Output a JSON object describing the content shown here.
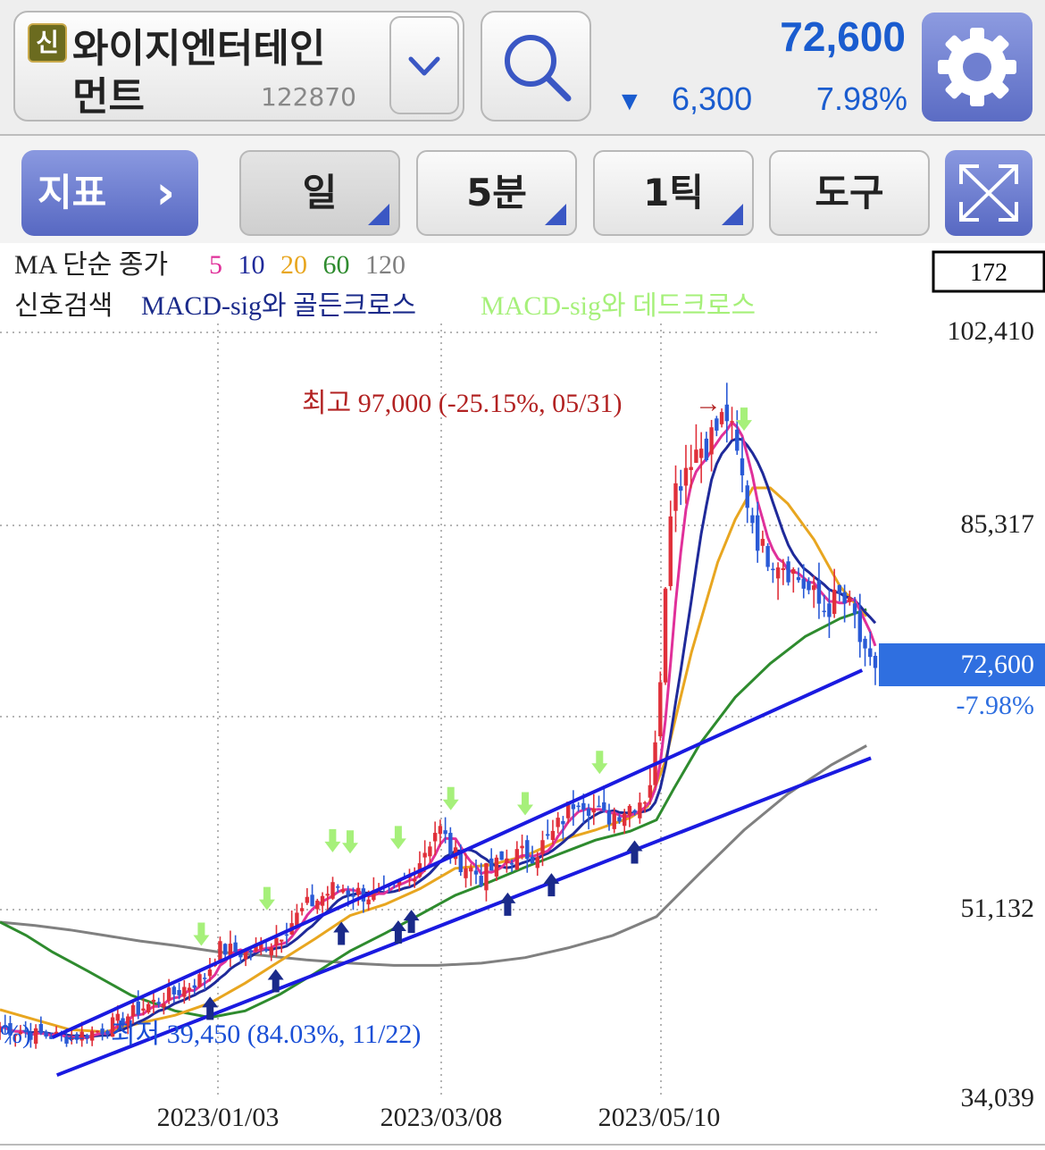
{
  "header": {
    "badge": "신",
    "name_line1": "와이지엔터테인",
    "name_line2": "먼트",
    "code": "122870",
    "price": "72,600",
    "change_arrow": "▼",
    "change_amount": "6,300",
    "change_pct": "7.98%"
  },
  "toolbar": {
    "indicator_label": "지표",
    "indicator_arrow": "›",
    "period_day": "일",
    "period_5min": "5분",
    "period_tick": "1틱",
    "tools": "도구"
  },
  "legend": {
    "ma_prefix": "MA 단순 종가",
    "ma_periods": [
      {
        "label": "5",
        "color": "#e0309a"
      },
      {
        "label": "10",
        "color": "#1f2a9a"
      },
      {
        "label": "20",
        "color": "#e8a620"
      },
      {
        "label": "60",
        "color": "#2e8b2e"
      },
      {
        "label": "120",
        "color": "#808080"
      }
    ],
    "signal_prefix": "신호검색",
    "signal_golden": "MACD-sig와 골든크로스",
    "signal_dead": "MACD-sig와 데드크로스",
    "count_box": "172"
  },
  "colors": {
    "up": "#e0303a",
    "down": "#2a5ad6",
    "trend": "#1a1ae0",
    "golden_arrow": "#1a2a8a",
    "dead_arrow": "#a6f07a",
    "high_label": "#b22222",
    "low_label": "#1a4fd6"
  },
  "chart_data": {
    "type": "candlestick",
    "y_ticks": [
      {
        "label": "102,410",
        "value": 102410
      },
      {
        "label": "85,317",
        "value": 85317
      },
      {
        "label": "51,132",
        "value": 51132
      },
      {
        "label": "34,039",
        "value": 34039
      }
    ],
    "x_ticks": [
      "2023/01/03",
      "2023/03/08",
      "2023/05/10"
    ],
    "current_price_label": "72,600",
    "current_change_label": "-7.98%",
    "high_annotation": "최고 97,000 (-25.15%, 05/31)",
    "high_annotation_arrow": "→",
    "low_annotation": "최저 39,450 (84.03%, 11/22)",
    "low_annotation_arrow": "←",
    "low_annotation_left_edge": "%)",
    "high_value": 97000,
    "low_value": 39450,
    "last_close": 72600,
    "trend_lines": [
      {
        "from": [
          0.06,
          39600
        ],
        "to": [
          0.985,
          72400
        ]
      },
      {
        "from": [
          0.065,
          36200
        ],
        "to": [
          0.995,
          64600
        ]
      }
    ],
    "guide_points": {
      "close": [
        [
          0.0,
          40500
        ],
        [
          0.04,
          39900
        ],
        [
          0.08,
          39600
        ],
        [
          0.12,
          40400
        ],
        [
          0.16,
          42200
        ],
        [
          0.2,
          43600
        ],
        [
          0.235,
          45200
        ],
        [
          0.25,
          47600
        ],
        [
          0.28,
          47200
        ],
        [
          0.31,
          48200
        ],
        [
          0.35,
          51400
        ],
        [
          0.385,
          53200
        ],
        [
          0.41,
          52600
        ],
        [
          0.44,
          52200
        ],
        [
          0.47,
          54200
        ],
        [
          0.5,
          58600
        ],
        [
          0.52,
          55800
        ],
        [
          0.55,
          54000
        ],
        [
          0.58,
          55800
        ],
        [
          0.61,
          56200
        ],
        [
          0.63,
          57600
        ],
        [
          0.66,
          61400
        ],
        [
          0.69,
          59200
        ],
        [
          0.72,
          60400
        ],
        [
          0.74,
          61400
        ],
        [
          0.75,
          66000
        ],
        [
          0.765,
          87400
        ],
        [
          0.79,
          91800
        ],
        [
          0.81,
          92800
        ],
        [
          0.83,
          95200
        ],
        [
          0.85,
          88600
        ],
        [
          0.87,
          83000
        ],
        [
          0.89,
          82400
        ],
        [
          0.91,
          80800
        ],
        [
          0.94,
          77800
        ],
        [
          0.96,
          78800
        ],
        [
          0.975,
          77400
        ],
        [
          0.99,
          72600
        ]
      ],
      "ma20": [
        [
          0.0,
          42100
        ],
        [
          0.04,
          41200
        ],
        [
          0.08,
          40300
        ],
        [
          0.12,
          40100
        ],
        [
          0.16,
          40900
        ],
        [
          0.2,
          41600
        ],
        [
          0.24,
          42700
        ],
        [
          0.28,
          44500
        ],
        [
          0.32,
          46500
        ],
        [
          0.36,
          48500
        ],
        [
          0.4,
          50600
        ],
        [
          0.44,
          51600
        ],
        [
          0.48,
          53000
        ],
        [
          0.52,
          54800
        ],
        [
          0.56,
          55100
        ],
        [
          0.6,
          55900
        ],
        [
          0.64,
          57300
        ],
        [
          0.68,
          58200
        ],
        [
          0.72,
          59300
        ],
        [
          0.74,
          60300
        ],
        [
          0.76,
          64300
        ],
        [
          0.79,
          74000
        ],
        [
          0.82,
          82000
        ],
        [
          0.84,
          85800
        ],
        [
          0.86,
          88600
        ],
        [
          0.88,
          88600
        ],
        [
          0.9,
          87200
        ],
        [
          0.93,
          84000
        ],
        [
          0.96,
          79800
        ],
        [
          0.99,
          77200
        ]
      ],
      "ma60": [
        [
          0.0,
          50000
        ],
        [
          0.03,
          48800
        ],
        [
          0.06,
          47300
        ],
        [
          0.1,
          45600
        ],
        [
          0.15,
          43400
        ],
        [
          0.2,
          42000
        ],
        [
          0.24,
          41400
        ],
        [
          0.28,
          42000
        ],
        [
          0.32,
          43500
        ],
        [
          0.36,
          45400
        ],
        [
          0.4,
          47400
        ],
        [
          0.44,
          49000
        ],
        [
          0.48,
          50700
        ],
        [
          0.52,
          52400
        ],
        [
          0.56,
          53600
        ],
        [
          0.6,
          54900
        ],
        [
          0.64,
          56100
        ],
        [
          0.68,
          57300
        ],
        [
          0.72,
          58100
        ],
        [
          0.75,
          59100
        ],
        [
          0.77,
          61900
        ],
        [
          0.8,
          65900
        ],
        [
          0.84,
          70000
        ],
        [
          0.88,
          73000
        ],
        [
          0.92,
          75400
        ],
        [
          0.96,
          77000
        ],
        [
          0.99,
          77800
        ]
      ],
      "ma120": [
        [
          0.0,
          50000
        ],
        [
          0.04,
          49700
        ],
        [
          0.08,
          49300
        ],
        [
          0.12,
          48800
        ],
        [
          0.16,
          48300
        ],
        [
          0.2,
          47900
        ],
        [
          0.25,
          47300
        ],
        [
          0.3,
          47000
        ],
        [
          0.35,
          46600
        ],
        [
          0.4,
          46300
        ],
        [
          0.45,
          46100
        ],
        [
          0.5,
          46100
        ],
        [
          0.55,
          46300
        ],
        [
          0.6,
          46800
        ],
        [
          0.65,
          47700
        ],
        [
          0.7,
          48800
        ],
        [
          0.75,
          50500
        ],
        [
          0.8,
          54400
        ],
        [
          0.85,
          58200
        ],
        [
          0.9,
          61400
        ],
        [
          0.95,
          64000
        ],
        [
          0.99,
          65700
        ]
      ]
    },
    "golden_cross_signals": [
      0.24,
      0.315,
      0.39,
      0.455,
      0.47,
      0.58,
      0.63,
      0.725
    ],
    "dead_cross_signals": [
      0.23,
      0.305,
      0.38,
      0.4,
      0.455,
      0.515,
      0.6,
      0.685,
      0.85
    ],
    "grid": true
  }
}
